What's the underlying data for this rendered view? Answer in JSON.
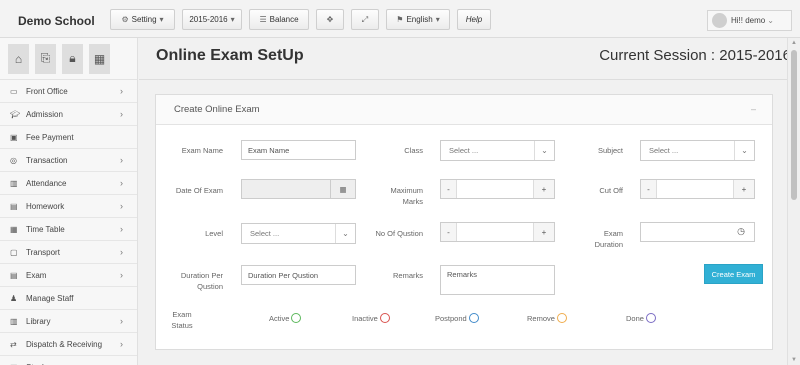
{
  "app": {
    "brand": "Demo School"
  },
  "toolbar": {
    "setting_label": "Setting",
    "session_label": "2015-2016",
    "balance_label": "Balance",
    "language_label": "English",
    "help_label": "Help",
    "user_label": "Hi!! demo"
  },
  "sidebar": {
    "items": [
      {
        "label": "Front Office",
        "icon": "monitor-icon",
        "chevron": "›"
      },
      {
        "label": "Admission",
        "icon": "graduation-cap-icon",
        "chevron": "›"
      },
      {
        "label": "Fee Payment",
        "icon": "money-icon",
        "chevron": ""
      },
      {
        "label": "Transaction",
        "icon": "dollar-icon",
        "chevron": "›"
      },
      {
        "label": "Attendance",
        "icon": "bar-chart-icon",
        "chevron": "›"
      },
      {
        "label": "Homework",
        "icon": "document-icon",
        "chevron": "›"
      },
      {
        "label": "Time Table",
        "icon": "calendar-icon",
        "chevron": "›"
      },
      {
        "label": "Transport",
        "icon": "bus-icon",
        "chevron": "›"
      },
      {
        "label": "Exam",
        "icon": "file-icon",
        "chevron": "›"
      },
      {
        "label": "Manage Staff",
        "icon": "users-icon",
        "chevron": ""
      },
      {
        "label": "Library",
        "icon": "book-icon",
        "chevron": "›"
      },
      {
        "label": "Dispatch & Receiving",
        "icon": "exchange-icon",
        "chevron": "›"
      },
      {
        "label": "Stock",
        "icon": "box-icon",
        "chevron": "›"
      }
    ]
  },
  "page": {
    "title": "Online Exam SetUp",
    "session": "Current Session : 2015-2016"
  },
  "panel": {
    "title": "Create Online Exam",
    "collapse_symbol": "–"
  },
  "form": {
    "exam_name_label": "Exam Name",
    "exam_name_value": "Exam Name",
    "class_label": "Class",
    "class_placeholder": "Select ...",
    "subject_label": "Subject",
    "subject_placeholder": "Select ...",
    "date_label": "Date Of Exam",
    "max_marks_label_1": "Maximum",
    "max_marks_label_2": "Marks",
    "cutoff_label": "Cut Off",
    "level_label": "Level",
    "level_placeholder": "Select ...",
    "no_questions_label": "No Of Qustion",
    "duration_label_1": "Exam",
    "duration_label_2": "Duration",
    "duration_per_label_1": "Duration Per",
    "duration_per_label_2": "Qustion",
    "duration_per_value": "Duration Per Qustion",
    "remarks_label": "Remarks",
    "remarks_value": "Remarks",
    "minus": "-",
    "plus": "+",
    "create_button": "Create Exam",
    "exam_status_label_1": "Exam",
    "exam_status_label_2": "Status"
  },
  "statuses": [
    {
      "label": "Active",
      "color": "#5cb85c"
    },
    {
      "label": "Inactive",
      "color": "#d9534f"
    },
    {
      "label": "Postpond",
      "color": "#428bca"
    },
    {
      "label": "Remove",
      "color": "#f0ad4e"
    },
    {
      "label": "Done",
      "color": "#7b6cc4"
    }
  ]
}
